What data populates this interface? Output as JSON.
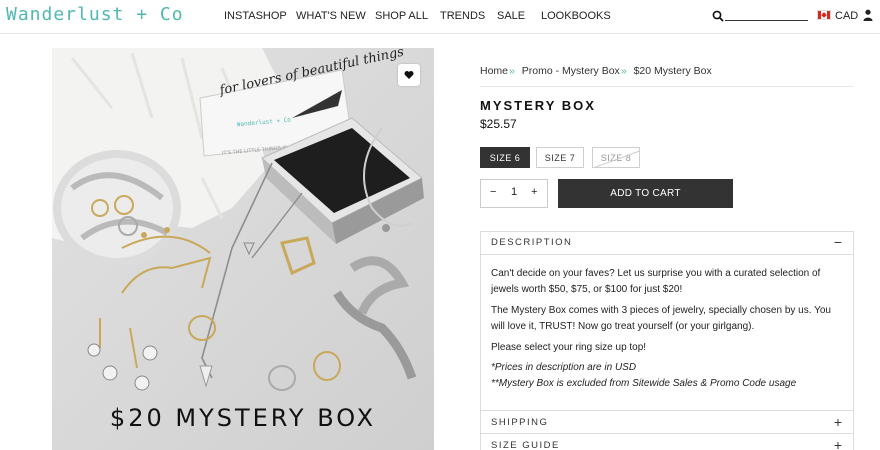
{
  "header": {
    "logo": "Wanderlust + Co",
    "nav": [
      "INSTASHOP",
      "WHAT'S NEW",
      "SHOP ALL",
      "TRENDS",
      "SALE",
      "LOOKBOOKS"
    ],
    "currency": "CAD",
    "icons": {
      "search": "search-icon",
      "user": "user-icon",
      "flag": "canada-flag-icon"
    }
  },
  "image": {
    "caption": "$20 MYSTERY BOX",
    "box_text": "for lovers of beautiful things",
    "box_brand": "Wanderlust + Co",
    "box_tagline": "IT'S THE LITTLE THINGS IN LIFE"
  },
  "breadcrumb": [
    {
      "label": "Home"
    },
    {
      "label": "Promo - Mystery Box"
    },
    {
      "label": "$20 Mystery Box"
    }
  ],
  "breadcrumb_sep": "»",
  "product": {
    "title": "MYSTERY BOX",
    "price": "$25.57",
    "sizes": [
      {
        "label": "SIZE 6",
        "state": "selected"
      },
      {
        "label": "SIZE 7",
        "state": "available"
      },
      {
        "label": "SIZE 8",
        "state": "sold-out"
      }
    ],
    "quantity": "1",
    "qty_minus": "−",
    "qty_plus": "+",
    "add_to_cart": "ADD TO CART"
  },
  "accordion": {
    "description": {
      "label": "DESCRIPTION",
      "toggle": "−",
      "paragraphs": [
        "Can't decide on your faves? Let us surprise you with a curated selection of jewels worth $50, $75, or $100 for just $20!",
        "The Mystery Box comes with 3 pieces of jewelry, specially chosen by us. You will love it, TRUST! Now go treat yourself (or your girlgang).",
        "Please select your ring size up top!"
      ],
      "notes": [
        "*Prices in description are in USD",
        "**Mystery Box is excluded from Sitewide Sales & Promo Code usage"
      ]
    },
    "shipping": {
      "label": "SHIPPING",
      "toggle": "+"
    },
    "size_guide": {
      "label": "SIZE GUIDE",
      "toggle": "+"
    }
  },
  "colors": {
    "accent": "#4fb8b0",
    "button_dark": "#333333"
  }
}
